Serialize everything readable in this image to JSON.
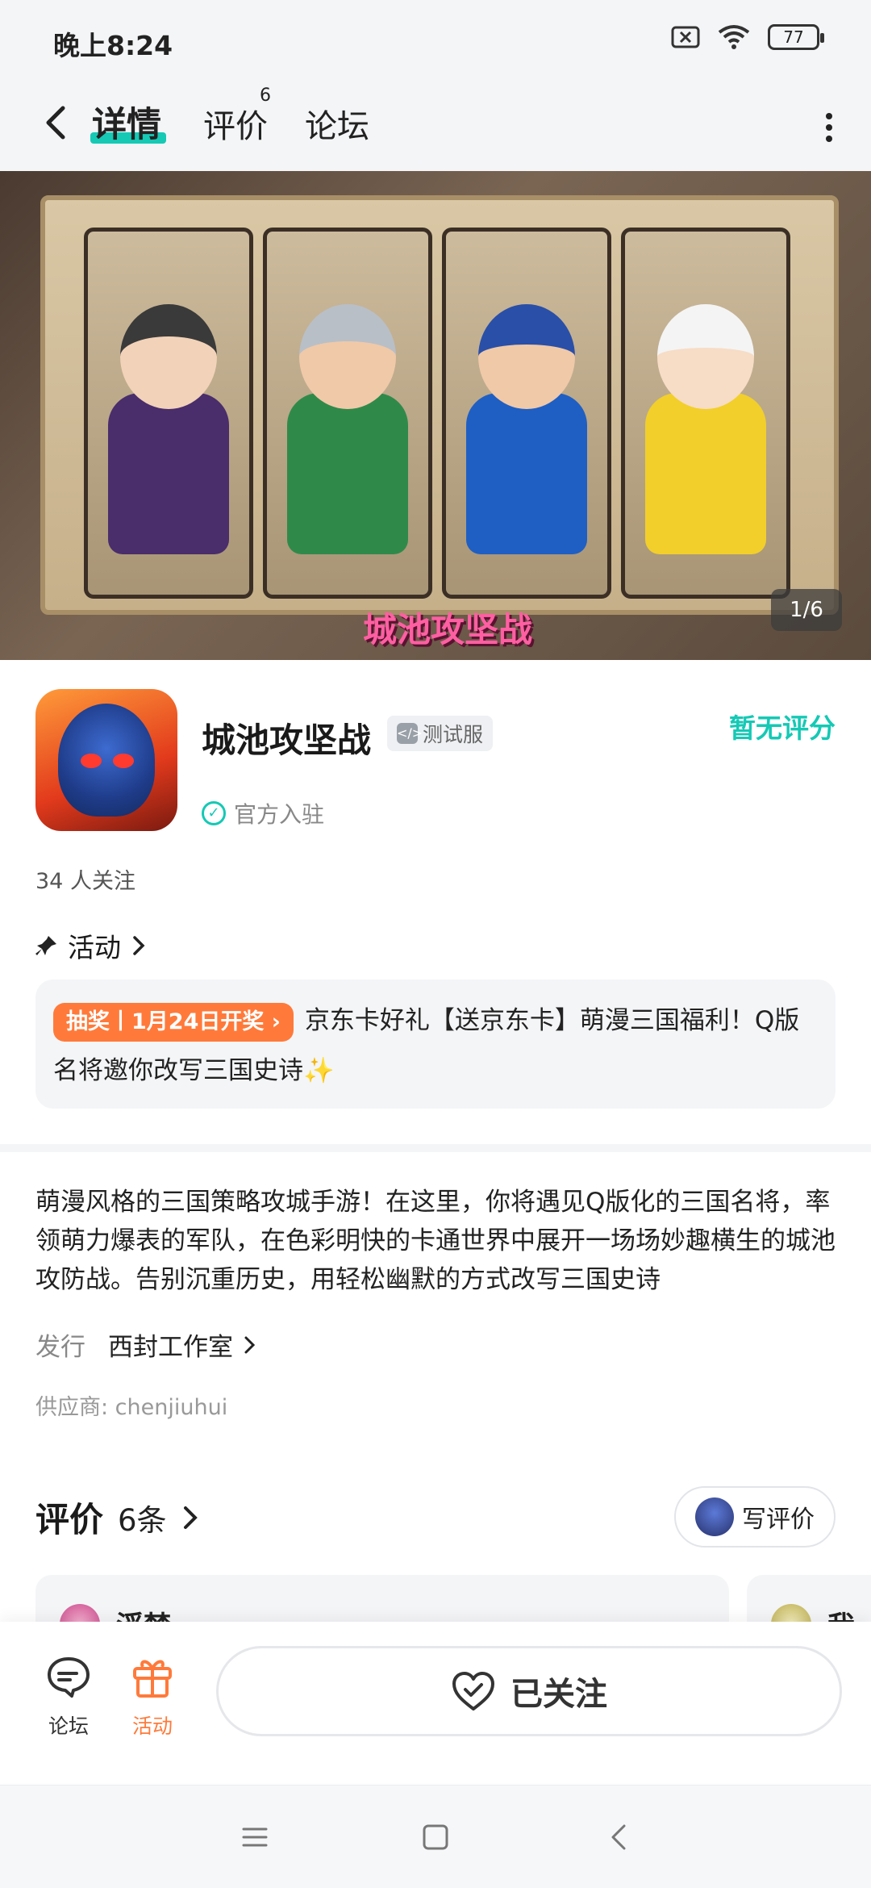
{
  "status_bar": {
    "time": "晚上8:24",
    "battery": "77"
  },
  "nav": {
    "tabs": [
      {
        "label": "详情",
        "active": true
      },
      {
        "label": "评价",
        "badge": "6"
      },
      {
        "label": "论坛"
      }
    ]
  },
  "banner": {
    "title": "城池攻坚战",
    "page_indicator": "1/6"
  },
  "app": {
    "name": "城池攻坚战",
    "test_badge": "测试服",
    "rating": "暂无评分",
    "official_label": "官方入驻",
    "followers": "34 人关注"
  },
  "activity": {
    "heading": "活动",
    "tag": "抽奖丨1月24日开奖",
    "text": "京东卡好礼【送京东卡】萌漫三国福利！Q版名将邀你改写三国史诗"
  },
  "description": {
    "text": "萌漫风格的三国策略攻城手游！在这里，你将遇见Q版化的三国名将，率领萌力爆表的军队，在色彩明快的卡通世界中展开一场场妙趣横生的城池攻防战。告别沉重历史，用轻松幽默的方式改写三国史诗",
    "publisher_label": "发行",
    "publisher": "西封工作室",
    "supplier": "供应商: chenjiuhui"
  },
  "reviews": {
    "title": "评价",
    "count": "6条",
    "write_button": "写评价",
    "cards": [
      {
        "name": "浮梦"
      },
      {
        "name": "我本"
      }
    ]
  },
  "action_bar": {
    "forum": "论坛",
    "activity": "活动",
    "follow": "已关注"
  },
  "colors": {
    "accent": "#15c9b5",
    "orange": "#ff7a3a"
  }
}
